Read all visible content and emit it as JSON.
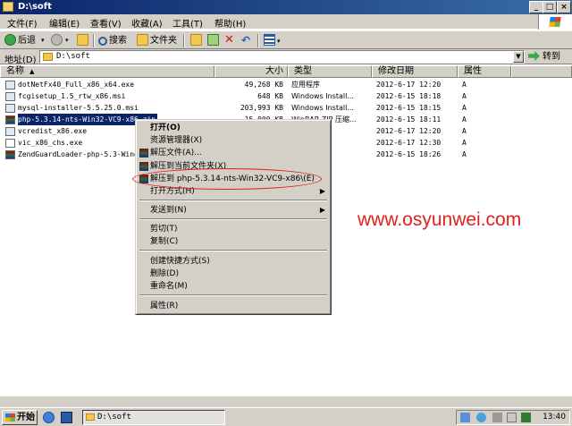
{
  "window": {
    "title": "D:\\soft"
  },
  "menubar": {
    "items": [
      "文件(F)",
      "编辑(E)",
      "查看(V)",
      "收藏(A)",
      "工具(T)",
      "帮助(H)"
    ]
  },
  "toolbar": {
    "back_label": "后退",
    "search_label": "搜索",
    "folders_label": "文件夹"
  },
  "address": {
    "label": "地址(D)",
    "value": "D:\\soft",
    "go_label": "转到"
  },
  "columns": [
    "名称",
    "大小",
    "类型",
    "修改日期",
    "属性"
  ],
  "files": [
    {
      "name": "dotNetFx40_Full_x86_x64.exe",
      "size": "49,268 KB",
      "type": "应用程序",
      "date": "2012-6-17 12:20",
      "attr": "A"
    },
    {
      "name": "fcgisetup_1.5_rtw_x86.msi",
      "size": "648 KB",
      "type": "Windows Install...",
      "date": "2012-6-15 18:18",
      "attr": "A"
    },
    {
      "name": "mysql-installer-5.5.25.0.msi",
      "size": "203,993 KB",
      "type": "Windows Install...",
      "date": "2012-6-15 18:15",
      "attr": "A"
    },
    {
      "name": "php-5.3.14-nts-Win32-VC9-x86.zip",
      "size": "15,000 KB",
      "type": "WinRAR ZIP 压缩...",
      "date": "2012-6-15 18:11",
      "attr": "A"
    },
    {
      "name": "vcredist_x86.exe",
      "size": "",
      "type": "",
      "date": "2012-6-17 12:20",
      "attr": "A"
    },
    {
      "name": "vic_x86_chs.exe",
      "size": "",
      "type": "",
      "date": "2012-6-17 12:30",
      "attr": "A"
    },
    {
      "name": "ZendGuardLoader-php-5.3-Windows.zip",
      "size": "",
      "type": "P 压缩...",
      "date": "2012-6-15 18:26",
      "attr": "A"
    }
  ],
  "context_menu": {
    "open": "打开(O)",
    "explorer": "资源管理器(X)",
    "extract_files": "解压文件(A)...",
    "extract_here": "解压到当前文件夹(X)",
    "extract_to": "解压到 php-5.3.14-nts-Win32-VC9-x86\\(E)",
    "open_with": "打开方式(H)",
    "send_to": "发送到(N)",
    "cut": "剪切(T)",
    "copy": "复制(C)",
    "create_shortcut": "创建快捷方式(S)",
    "delete": "删除(D)",
    "rename": "重命名(M)",
    "properties": "属性(R)"
  },
  "watermark": "www.osyunwei.com",
  "taskbar": {
    "start_label": "开始",
    "task_label": "D:\\soft",
    "clock": "13:40"
  },
  "colors": {
    "titlebar": "#0a246a",
    "selection": "#0a246a",
    "watermark": "#e0201e",
    "face": "#d4d0c8"
  }
}
